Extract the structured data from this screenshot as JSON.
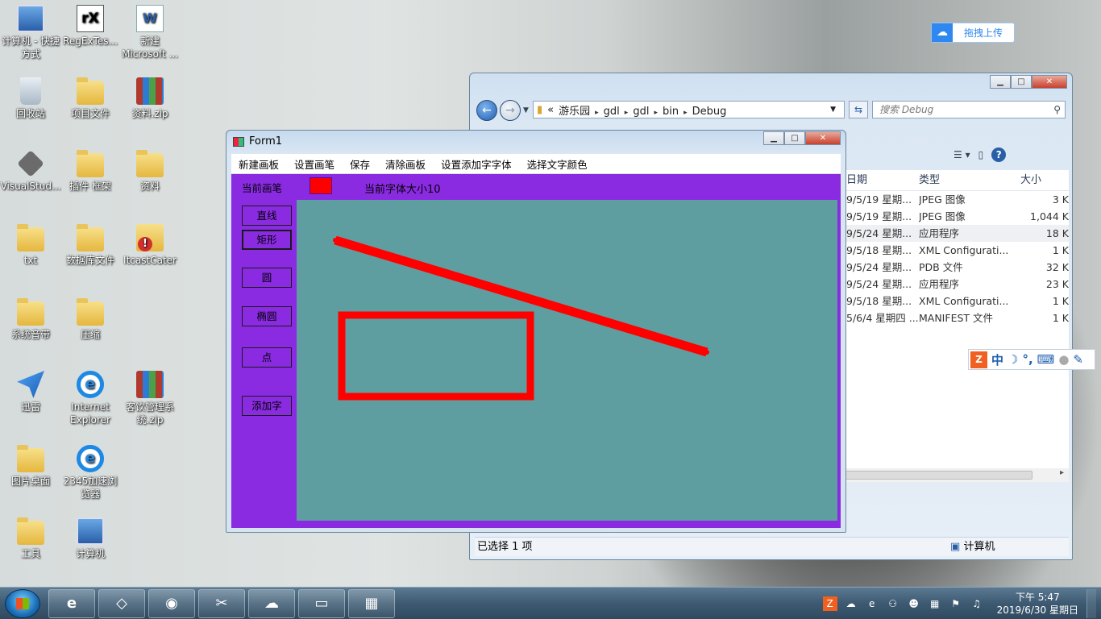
{
  "desktop": {
    "icons": [
      {
        "label": "计算机 - 快捷方式",
        "icon": "computer-shortcut-icon"
      },
      {
        "label": "RegExTes...",
        "icon": "regex-tester-icon"
      },
      {
        "label": "新建 Microsoft ...",
        "icon": "word-document-icon"
      },
      {
        "label": "回收站",
        "icon": "recycle-bin-icon"
      },
      {
        "label": "项目文件",
        "icon": "folder-icon"
      },
      {
        "label": "资料.zip",
        "icon": "zip-archive-icon"
      },
      {
        "label": "VisualStud...",
        "icon": "visual-studio-icon"
      },
      {
        "label": "插件  框架",
        "icon": "folder-icon"
      },
      {
        "label": "资料",
        "icon": "folder-icon"
      },
      {
        "label": "txt",
        "icon": "folder-icon"
      },
      {
        "label": "数据库文件",
        "icon": "folder-icon"
      },
      {
        "label": "ItcastCater",
        "icon": "folder-warning-icon"
      },
      {
        "label": "系统音带",
        "icon": "folder-icon"
      },
      {
        "label": "压缩",
        "icon": "folder-icon"
      },
      {
        "label": "迅雷",
        "icon": "thunder-icon"
      },
      {
        "label": "Internet Explorer",
        "icon": "ie-icon"
      },
      {
        "label": "客饮管理系统.zip",
        "icon": "zip-archive-icon"
      },
      {
        "label": "图片桌面",
        "icon": "folder-icon"
      },
      {
        "label": "2345加速浏览器",
        "icon": "browser-2345-icon"
      },
      {
        "label": "工具",
        "icon": "folder-icon"
      },
      {
        "label": "计算机",
        "icon": "computer-icon"
      }
    ],
    "baidu_upload": {
      "label": "拖拽上传",
      "icon": "baidu-cloud-icon"
    }
  },
  "explorer": {
    "address": {
      "prefix": "«",
      "crumbs": [
        "游乐园",
        "gdl",
        "gdl",
        "bin",
        "Debug"
      ]
    },
    "search_placeholder": "搜索 Debug",
    "columns": {
      "date": "日期",
      "type": "类型",
      "size": "大小"
    },
    "rows": [
      {
        "date": "9/5/19 星期...",
        "type": "JPEG 图像",
        "size": "3 K"
      },
      {
        "date": "9/5/19 星期...",
        "type": "JPEG 图像",
        "size": "1,044 K"
      },
      {
        "date": "9/5/24 星期...",
        "type": "应用程序",
        "size": "18 K",
        "selected": true
      },
      {
        "date": "9/5/18 星期...",
        "type": "XML Configurati...",
        "size": "1 K"
      },
      {
        "date": "9/5/24 星期...",
        "type": "PDB 文件",
        "size": "32 K"
      },
      {
        "date": "9/5/24 星期...",
        "type": "应用程序",
        "size": "23 K"
      },
      {
        "date": "9/5/18 星期...",
        "type": "XML Configurati...",
        "size": "1 K"
      },
      {
        "date": "5/6/4 星期四 ...",
        "type": "MANIFEST 文件",
        "size": "1 K"
      }
    ],
    "status": {
      "selection": "已选择 1 项",
      "location": "计算机"
    }
  },
  "ime": {
    "mode": "中"
  },
  "form1": {
    "title": "Form1",
    "menu": [
      "新建画板",
      "设置画笔",
      "保存",
      "清除画板",
      "设置添加字字体",
      "选择文字颜色"
    ],
    "current_pen_label": "当前画笔",
    "current_pen_color": "#ff0000",
    "font_size_label": "当前字体大小10",
    "tools": [
      {
        "label": "直线",
        "active": false
      },
      {
        "label": "矩形",
        "active": true
      },
      {
        "label": "圆",
        "active": false
      },
      {
        "label": "椭圆",
        "active": false
      },
      {
        "label": "点",
        "active": false
      },
      {
        "label": "添加字",
        "active": false
      }
    ],
    "canvas_color": "#5f9ea0",
    "form_color": "#8a2be2"
  },
  "taskbar": {
    "apps": [
      "ie-icon",
      "visual-studio-icon",
      "media-icon",
      "tools-icon",
      "baidu-cloud-icon",
      "explorer-folder-icon",
      "form-app-icon"
    ],
    "clock": {
      "time": "下午 5:47",
      "date": "2019/6/30 星期日"
    }
  }
}
